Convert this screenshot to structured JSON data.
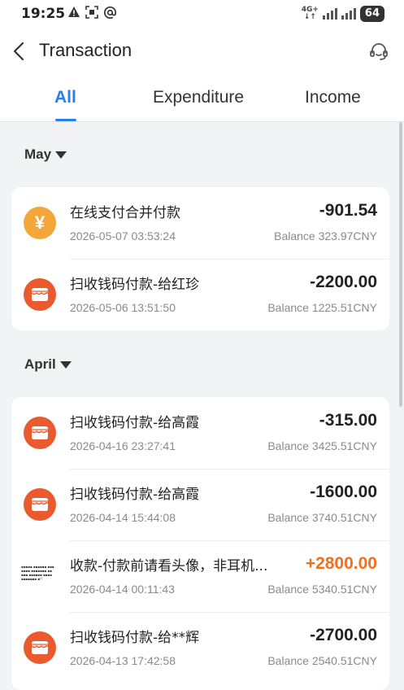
{
  "status_bar": {
    "time": "19:25",
    "network": "4G+",
    "battery": "64"
  },
  "header": {
    "title": "Transaction"
  },
  "tabs": [
    {
      "label": "All"
    },
    {
      "label": "Expenditure"
    },
    {
      "label": "Income"
    }
  ],
  "groups": [
    {
      "month": "May",
      "items": [
        {
          "icon": "yen-icon",
          "description": "在线支付合并付款",
          "datetime": "2026-05-07 03:53:24",
          "amount": "-901.54",
          "balance": "Balance 323.97CNY"
        },
        {
          "icon": "shop-icon",
          "description": "扫收钱码付款-给红珍",
          "datetime": "2026-05-06 13:51:50",
          "amount": "-2200.00",
          "balance": "Balance 1225.51CNY"
        }
      ]
    },
    {
      "month": "April",
      "items": [
        {
          "icon": "shop-icon",
          "description": "扫收钱码付款-给高霞",
          "datetime": "2026-04-16 23:27:41",
          "amount": "-315.00",
          "balance": "Balance 3425.51CNY"
        },
        {
          "icon": "shop-icon",
          "description": "扫收钱码付款-给高霞",
          "datetime": "2026-04-14 15:44:08",
          "amount": "-1600.00",
          "balance": "Balance 3740.51CNY"
        },
        {
          "icon": "image-thumbnail",
          "description": "收款-付款前请看头像，非耳机...",
          "datetime": "2026-04-14 00:11:43",
          "amount": "+2800.00",
          "balance": "Balance 5340.51CNY"
        },
        {
          "icon": "shop-icon",
          "description": "扫收钱码付款-给**辉",
          "datetime": "2026-04-13 17:42:58",
          "amount": "-2700.00",
          "balance": "Balance 2540.51CNY"
        }
      ]
    }
  ],
  "colors": {
    "accent": "#2a7ef0",
    "income": "#f07020",
    "shop_icon": "#ea5a2f",
    "yen_icon": "#f3a73a"
  }
}
